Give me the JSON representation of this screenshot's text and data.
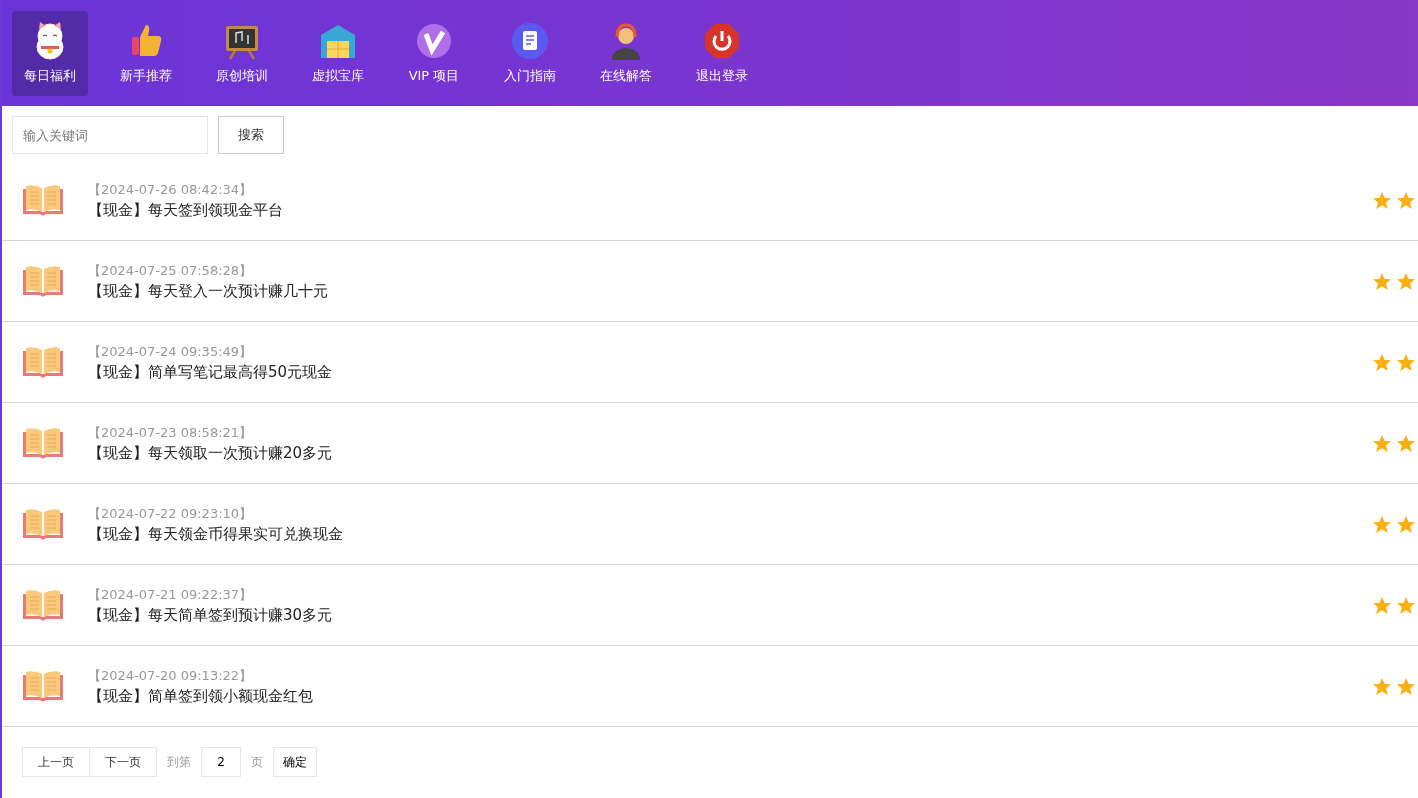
{
  "nav": [
    {
      "label": "每日福利",
      "selected": true
    },
    {
      "label": "新手推荐",
      "selected": false
    },
    {
      "label": "原创培训",
      "selected": false
    },
    {
      "label": "虚拟宝库",
      "selected": false
    },
    {
      "label": "VIP 项目",
      "selected": false
    },
    {
      "label": "入门指南",
      "selected": false
    },
    {
      "label": "在线解答",
      "selected": false
    },
    {
      "label": "退出登录",
      "selected": false
    }
  ],
  "search": {
    "placeholder": "输入关键词",
    "button": "搜索"
  },
  "articles": [
    {
      "date": "【2024-07-26 08:42:34】",
      "title": "【现金】每天签到领现金平台"
    },
    {
      "date": "【2024-07-25 07:58:28】",
      "title": "【现金】每天登入一次预计赚几十元"
    },
    {
      "date": "【2024-07-24 09:35:49】",
      "title": "【现金】简单写笔记最高得50元现金"
    },
    {
      "date": "【2024-07-23 08:58:21】",
      "title": "【现金】每天领取一次预计赚20多元"
    },
    {
      "date": "【2024-07-22 09:23:10】",
      "title": "【现金】每天领金币得果实可兑换现金"
    },
    {
      "date": "【2024-07-21 09:22:37】",
      "title": "【现金】每天简单签到预计赚30多元"
    },
    {
      "date": "【2024-07-20 09:13:22】",
      "title": "【现金】简单签到领小额现金红包"
    }
  ],
  "pagination": {
    "prev": "上一页",
    "next": "下一页",
    "goto_label": "到第",
    "page_value": "2",
    "page_suffix": "页",
    "confirm": "确定"
  }
}
